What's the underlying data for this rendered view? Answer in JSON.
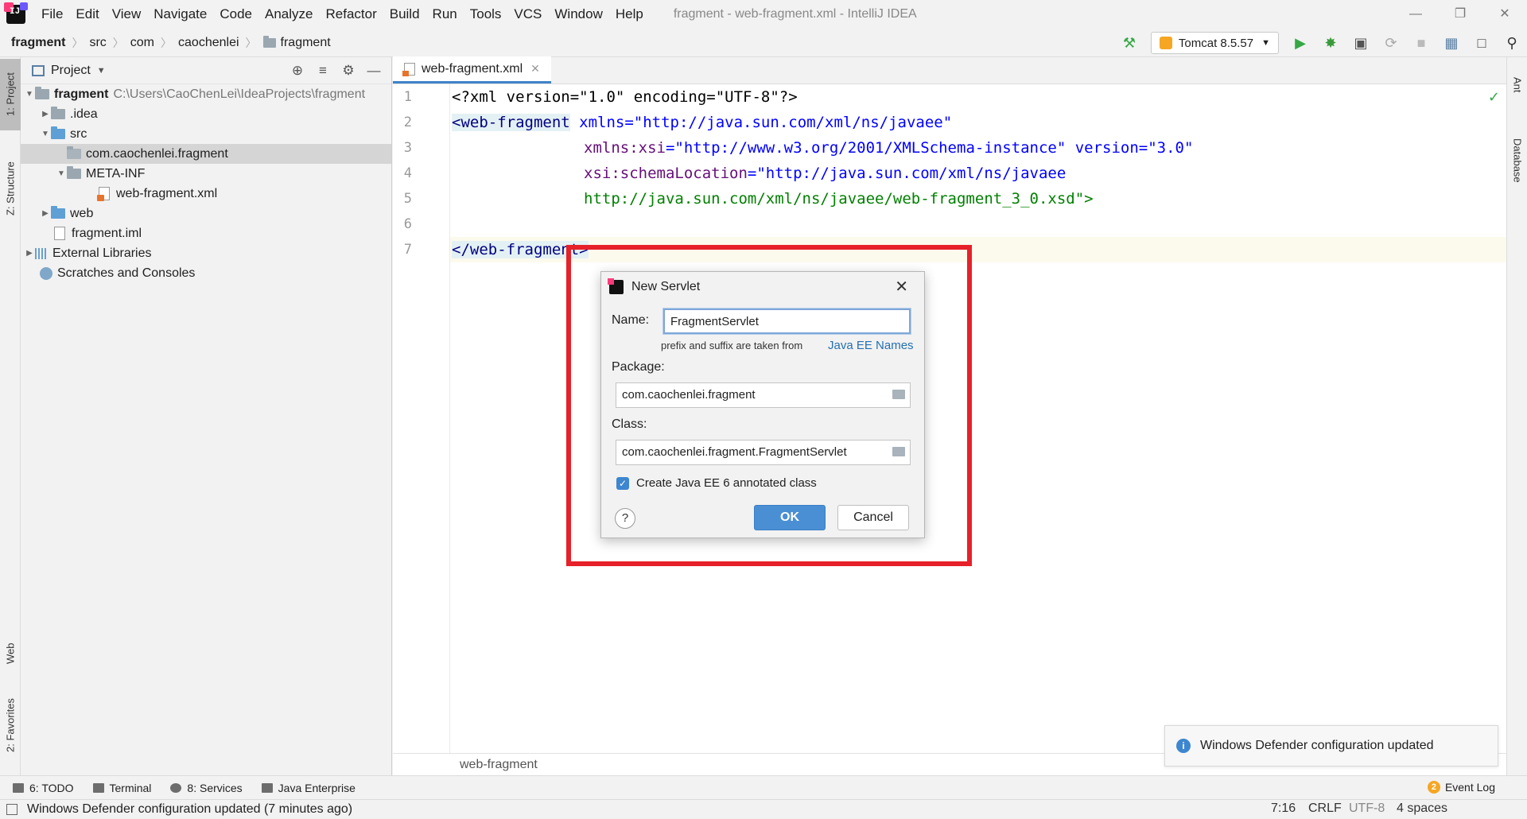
{
  "menubar": {
    "items": [
      "File",
      "Edit",
      "View",
      "Navigate",
      "Code",
      "Analyze",
      "Refactor",
      "Build",
      "Run",
      "Tools",
      "VCS",
      "Window",
      "Help"
    ],
    "window_title": "fragment - web-fragment.xml - IntelliJ IDEA"
  },
  "navbar": {
    "crumbs": [
      "fragment",
      "src",
      "com",
      "caochenlei",
      "fragment"
    ],
    "run_config": "Tomcat 8.5.57"
  },
  "left_stripe": {
    "project": "1: Project",
    "structure": "Z: Structure",
    "web": "Web",
    "favorites": "2: Favorites"
  },
  "right_stripe": {
    "ant": "Ant",
    "database": "Database"
  },
  "project_panel": {
    "title": "Project",
    "tree": [
      {
        "label": "fragment",
        "hint": "C:\\Users\\CaoChenLei\\IdeaProjects\\fragment"
      },
      {
        "label": ".idea"
      },
      {
        "label": "src"
      },
      {
        "label": "com.caochenlei.fragment"
      },
      {
        "label": "META-INF"
      },
      {
        "label": "web-fragment.xml"
      },
      {
        "label": "web"
      },
      {
        "label": "fragment.iml"
      },
      {
        "label": "External Libraries"
      },
      {
        "label": "Scratches and Consoles"
      }
    ]
  },
  "editor": {
    "tab": "web-fragment.xml",
    "line_numbers": [
      "1",
      "2",
      "3",
      "4",
      "5",
      "6",
      "7"
    ],
    "lines": {
      "l1": "<?xml version=\"1.0\" encoding=\"UTF-8\"?>",
      "l2_tag": "<web-fragment",
      "l2_rest": " xmlns=\"http://java.sun.com/xml/ns/javaee\"",
      "l3_ns": "xmlns:xsi",
      "l3_rest": "=\"http://www.w3.org/2001/XMLSchema-instance\" version=\"3.0\"",
      "l4_ns": "xsi:schemaLocation",
      "l4_rest": "=\"http://java.sun.com/xml/ns/javaee",
      "l5": "http://java.sun.com/xml/ns/javaee/web-fragment_3_0.xsd\">",
      "l7": "</web-fragment>"
    },
    "bottom_breadcrumb": "web-fragment"
  },
  "dialog": {
    "title": "New Servlet",
    "name_label": "Name:",
    "name_value": "FragmentServlet",
    "hint": "prefix and suffix are taken from",
    "hint_link": "Java EE Names",
    "package_label": "Package:",
    "package_value": "com.caochenlei.fragment",
    "class_label": "Class:",
    "class_value": "com.caochenlei.fragment.FragmentServlet",
    "checkbox_label": "Create Java EE 6 annotated class",
    "checkbox_checked": true,
    "ok": "OK",
    "cancel": "Cancel",
    "help": "?"
  },
  "notification": {
    "text": "Windows Defender configuration updated"
  },
  "bottom_tools": {
    "todo": "6: TODO",
    "terminal": "Terminal",
    "services": "8: Services",
    "java_enterprise": "Java Enterprise",
    "event_log": "Event Log",
    "event_count": "2"
  },
  "statusbar": {
    "message": "Windows Defender configuration updated (7 minutes ago)",
    "position": "7:16",
    "line_sep": "CRLF",
    "encoding": "UTF-8",
    "indent": "4 spaces"
  },
  "colors": {
    "accent": "#4a8fd4",
    "highlight_box": "#e6212a",
    "run_green": "#35a844"
  }
}
